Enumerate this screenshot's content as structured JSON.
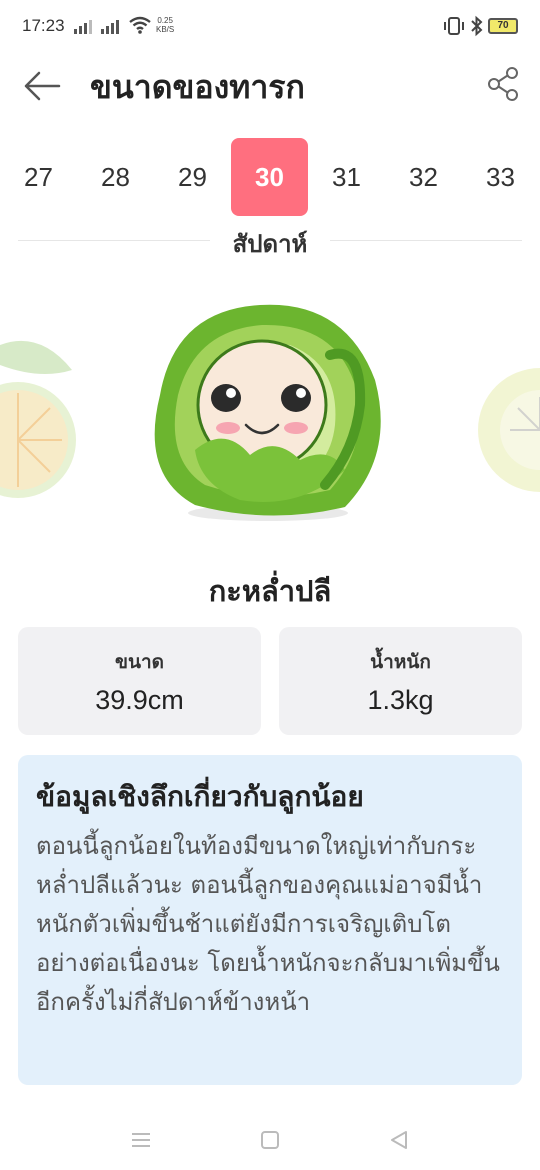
{
  "status": {
    "time": "17:23",
    "net_speed_value": "0.25",
    "net_speed_unit": "KB/S",
    "battery": "70"
  },
  "header": {
    "title": "ขนาดของทารก"
  },
  "weeks": {
    "items": [
      "27",
      "28",
      "29",
      "30",
      "31",
      "32",
      "33"
    ],
    "selected": "30",
    "label": "สัปดาห์"
  },
  "fruit": {
    "name": "กะหล่ำปลี"
  },
  "stats": {
    "size_label": "ขนาด",
    "size_value": "39.9cm",
    "weight_label": "น้ำหนัก",
    "weight_value": "1.3kg"
  },
  "insight": {
    "title": "ข้อมูลเชิงลึกเกี่ยวกับลูกน้อย",
    "body": "ตอนนี้ลูกน้อยในท้องมีขนาดใหญ่เท่ากับกระหล่ำปลีแล้วนะ ตอนนี้ลูกของคุณแม่อาจมีน้ำหนักตัวเพิ่มขึ้นช้าแต่ยังมีการเจริญเติบโตอย่างต่อเนื่องนะ โดยน้ำหนักจะกลับมาเพิ่มขึ้นอีกครั้งไม่กี่สัปดาห์ข้างหน้า"
  },
  "colors": {
    "accent": "#ff6f7f",
    "card_bg": "#f1f1f3",
    "insight_bg": "#e3f0fb"
  },
  "icons": {
    "back": "back-arrow-icon",
    "share": "share-icon",
    "nav_menu": "menu-icon",
    "nav_home": "home-square-icon",
    "nav_back": "back-triangle-icon"
  }
}
